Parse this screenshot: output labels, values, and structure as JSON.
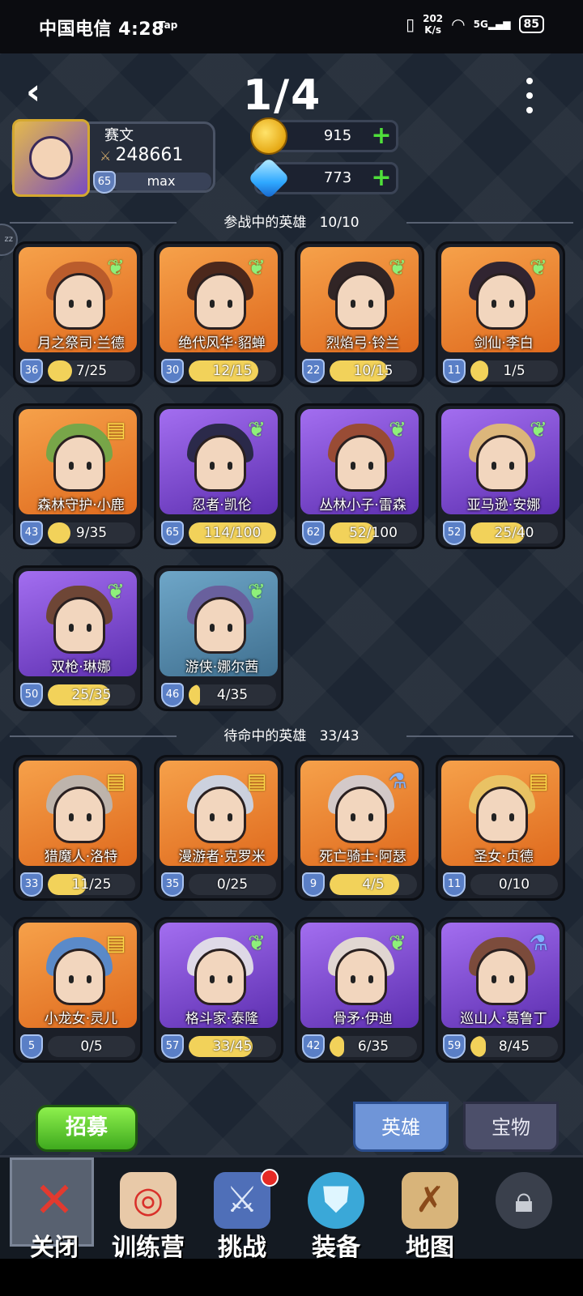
{
  "status_bar": {
    "carrier_time": "中国电信 4:28",
    "tap": "Tap",
    "speed_value": "202",
    "speed_unit": "K/s",
    "signal": "5G",
    "battery": "85"
  },
  "header": {
    "page_indicator": "1/4"
  },
  "profile": {
    "name": "赛文",
    "power": "248661",
    "level": "65",
    "xp_text": "max"
  },
  "resources": {
    "gold": "915",
    "gems": "773"
  },
  "side_bubble": "zz",
  "active_section": {
    "title": "参战中的英雄",
    "count": "10/10"
  },
  "active_heroes": [
    {
      "name": "月之祭司·兰德",
      "level": "36",
      "progress": "7/25",
      "fraction": 0.28,
      "badge": "wing-icon",
      "bg": "orange",
      "hair": "#b4562a"
    },
    {
      "name": "绝代风华·貂蝉",
      "level": "30",
      "progress": "12/15",
      "fraction": 0.8,
      "badge": "wing-icon",
      "bg": "orange",
      "hair": "#3a1d18"
    },
    {
      "name": "烈焰弓·铃兰",
      "level": "22",
      "progress": "10/15",
      "fraction": 0.67,
      "badge": "wing-icon",
      "bg": "orange",
      "hair": "#1c1a24"
    },
    {
      "name": "剑仙·李白",
      "level": "11",
      "progress": "1/5",
      "fraction": 0.2,
      "badge": "wing-icon",
      "bg": "orange",
      "hair": "#1c1a30"
    },
    {
      "name": "森林守护·小鹿",
      "level": "43",
      "progress": "9/35",
      "fraction": 0.26,
      "badge": "book-icon",
      "bg": "orange",
      "hair": "#6aa84a"
    },
    {
      "name": "忍者·凯伦",
      "level": "65",
      "progress": "114/100",
      "fraction": 1.0,
      "badge": "wing-icon",
      "bg": "purple",
      "hair": "#20253a"
    },
    {
      "name": "丛林小子·雷森",
      "level": "62",
      "progress": "52/100",
      "fraction": 0.52,
      "badge": "wing-icon",
      "bg": "purple",
      "hair": "#9a4a22"
    },
    {
      "name": "亚马逊·安娜",
      "level": "52",
      "progress": "25/40",
      "fraction": 0.62,
      "badge": "wing-icon",
      "bg": "purple",
      "hair": "#e4c070"
    },
    {
      "name": "双枪·琳娜",
      "level": "50",
      "progress": "25/35",
      "fraction": 0.71,
      "badge": "wing-icon",
      "bg": "purple",
      "hair": "#6a4424"
    },
    {
      "name": "游侠·娜尔茜",
      "level": "46",
      "progress": "4/35",
      "fraction": 0.11,
      "badge": "wing-icon",
      "bg": "blue",
      "hair": "#6a5a9a"
    }
  ],
  "reserve_section": {
    "title": "待命中的英雄",
    "count": "33/43"
  },
  "reserve_heroes": [
    {
      "name": "猎魔人·洛特",
      "level": "33",
      "progress": "11/25",
      "fraction": 0.44,
      "badge": "book-icon",
      "bg": "orange",
      "hair": "#b8b8b8"
    },
    {
      "name": "漫游者·克罗米",
      "level": "35",
      "progress": "0/25",
      "fraction": 0.0,
      "badge": "book-icon",
      "bg": "orange",
      "hair": "#c8d8f0"
    },
    {
      "name": "死亡骑士·阿瑟",
      "level": "9",
      "progress": "4/5",
      "fraction": 0.8,
      "badge": "potion-icon",
      "bg": "orange",
      "hair": "#cfcfd8"
    },
    {
      "name": "圣女·贞德",
      "level": "11",
      "progress": "0/10",
      "fraction": 0.0,
      "badge": "book-icon",
      "bg": "orange",
      "hair": "#e8c868"
    },
    {
      "name": "小龙女·灵儿",
      "level": "5",
      "progress": "0/5",
      "fraction": 0.0,
      "badge": "book-icon",
      "bg": "orange",
      "hair": "#4a8ad8"
    },
    {
      "name": "格斗家·泰隆",
      "level": "57",
      "progress": "33/45",
      "fraction": 0.73,
      "badge": "wing-icon",
      "bg": "purple",
      "hair": "#e8e8e8"
    },
    {
      "name": "骨矛·伊迪",
      "level": "42",
      "progress": "6/35",
      "fraction": 0.17,
      "badge": "wing-icon",
      "bg": "purple",
      "hair": "#eae4d0"
    },
    {
      "name": "巡山人·葛鲁丁",
      "level": "59",
      "progress": "8/45",
      "fraction": 0.18,
      "badge": "potion-icon",
      "bg": "purple",
      "hair": "#7a4a2a"
    }
  ],
  "footer": {
    "recruit": "招募",
    "tab_heroes": "英雄",
    "tab_treasure": "宝物"
  },
  "bottom_nav": [
    {
      "label": "关闭",
      "icon": "close-icon"
    },
    {
      "label": "训练营",
      "icon": "target-icon"
    },
    {
      "label": "挑战",
      "icon": "sword-icon"
    },
    {
      "label": "装备",
      "icon": "armor-icon"
    },
    {
      "label": "地图",
      "icon": "map-icon"
    },
    {
      "label": "",
      "icon": "locked-icon"
    }
  ],
  "colors": {
    "bar_fill": "#f2d25a",
    "plus": "#4fe03a",
    "tab_active": "#6f95d8"
  }
}
